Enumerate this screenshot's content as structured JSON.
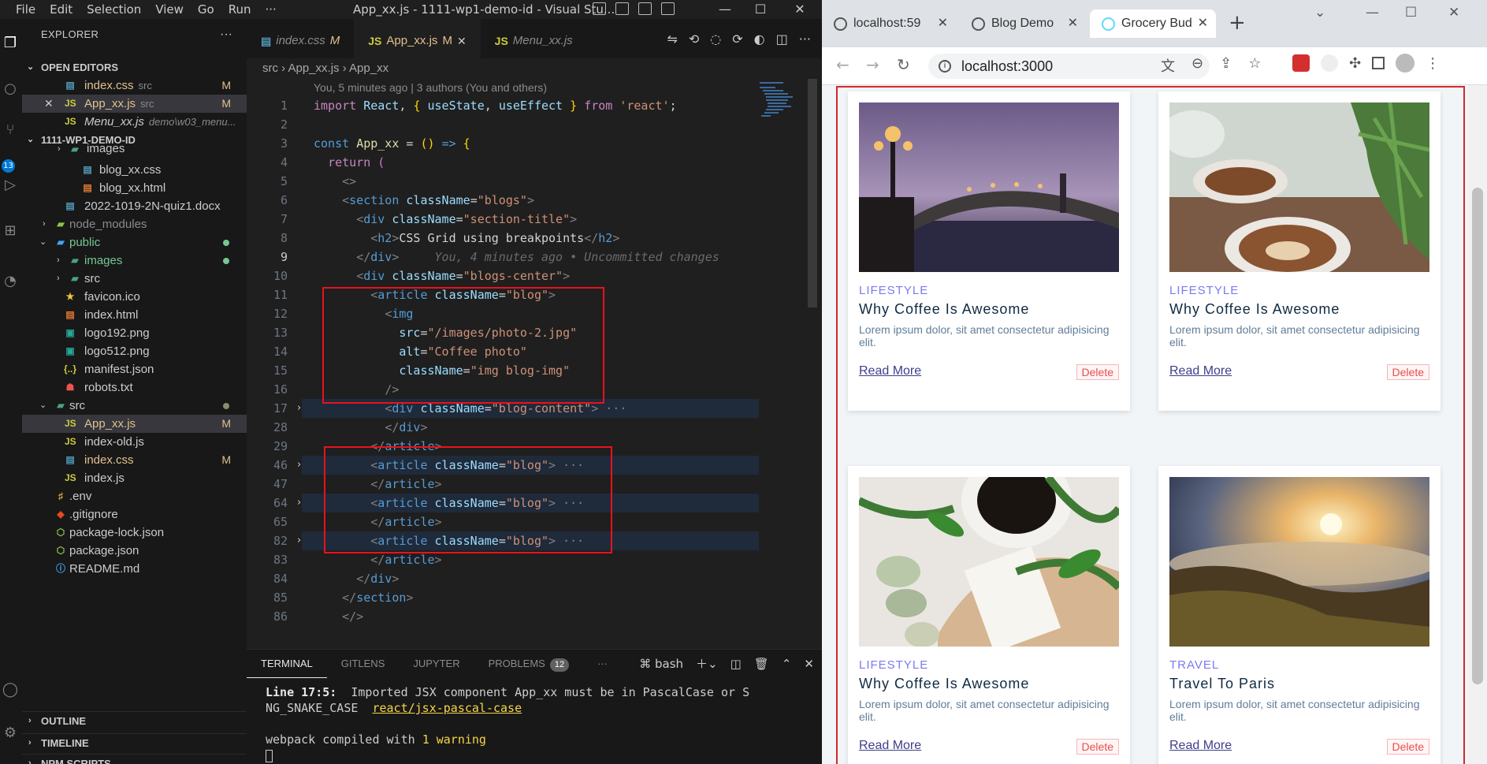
{
  "vscode": {
    "menu": [
      "File",
      "Edit",
      "Selection",
      "View",
      "Go",
      "Run",
      "···"
    ],
    "window_title": "App_xx.js - 1111-wp1-demo-id - Visual Stu...",
    "activity_badge": "13",
    "explorer_title": "EXPLORER",
    "open_editors_header": "OPEN EDITORS",
    "open_editors": [
      {
        "name": "index.css",
        "desc": "src",
        "mod": "M"
      },
      {
        "name": "App_xx.js",
        "desc": "src",
        "mod": "M"
      },
      {
        "name": "Menu_xx.js",
        "desc": "demo\\w03_menu..."
      }
    ],
    "project_header": "1111-WP1-DEMO-ID",
    "tree": [
      "images",
      "blog_xx.css",
      "blog_xx.html",
      "2022-1019-2N-quiz1.docx",
      "node_modules",
      "public",
      "images",
      "src",
      "favicon.ico",
      "index.html",
      "logo192.png",
      "logo512.png",
      "manifest.json",
      "robots.txt",
      "src",
      "App_xx.js",
      "index-old.js",
      "index.css",
      "index.js",
      ".env",
      ".gitignore",
      "package-lock.json",
      "package.json",
      "README.md"
    ],
    "tree_mod": "M",
    "bottom_sections": [
      "OUTLINE",
      "TIMELINE",
      "NPM SCRIPTS"
    ],
    "tabs": [
      {
        "name": "index.css",
        "mod": "M"
      },
      {
        "name": "App_xx.js",
        "mod": "M"
      },
      {
        "name": "Menu_xx.js",
        "mod": ""
      }
    ],
    "breadcrumb": "src  ›  App_xx.js  ›  App_xx",
    "blame": "You, 5 minutes ago | 3 authors (You and others)",
    "line_numbers": [
      "1",
      "2",
      "3",
      "4",
      "5",
      "6",
      "7",
      "8",
      "9",
      "10",
      "11",
      "12",
      "13",
      "14",
      "15",
      "16",
      "17",
      "28",
      "29",
      "46",
      "47",
      "64",
      "65",
      "82",
      "83",
      "84",
      "85",
      "86"
    ],
    "inline_blame": "You, 4 minutes ago • Uncommitted changes",
    "panel_tabs": [
      "TERMINAL",
      "GITLENS",
      "JUPYTER",
      "PROBLEMS"
    ],
    "problems_count": "12",
    "terminal_shell": "bash",
    "terminal": {
      "line1_bold": "Line 17:5:",
      "line1_rest": "  Imported JSX component App_xx must be in PascalCase or S",
      "line2": "NG_SNAKE_CASE  ",
      "line2_link": "react/jsx-pascal-case",
      "line3_a": "webpack compiled with ",
      "line3_b": "1 warning"
    }
  },
  "browser": {
    "tabs": [
      {
        "title": "localhost:59"
      },
      {
        "title": "Blog Demo"
      },
      {
        "title": "Grocery Bud"
      }
    ],
    "url": "localhost:3000",
    "posts": [
      {
        "category": "LIFESTYLE",
        "title": "Why Coffee Is Awesome",
        "text": "Lorem ipsum dolor, sit amet consectetur adipisicing elit.",
        "read": "Read More",
        "delete": "Delete"
      },
      {
        "category": "LIFESTYLE",
        "title": "Why Coffee Is Awesome",
        "text": "Lorem ipsum dolor, sit amet consectetur adipisicing elit.",
        "read": "Read More",
        "delete": "Delete"
      },
      {
        "category": "LIFESTYLE",
        "title": "Why Coffee Is Awesome",
        "text": "Lorem ipsum dolor, sit amet consectetur adipisicing elit.",
        "read": "Read More",
        "delete": "Delete"
      },
      {
        "category": "TRAVEL",
        "title": "Travel To Paris",
        "text": "Lorem ipsum dolor, sit amet consectetur adipisicing elit.",
        "read": "Read More",
        "delete": "Delete"
      }
    ]
  },
  "colors": {
    "accent": "#0078d4",
    "highlight_box": "#e8121e",
    "link": "#3e3e8b",
    "category": "#7a7af0"
  }
}
